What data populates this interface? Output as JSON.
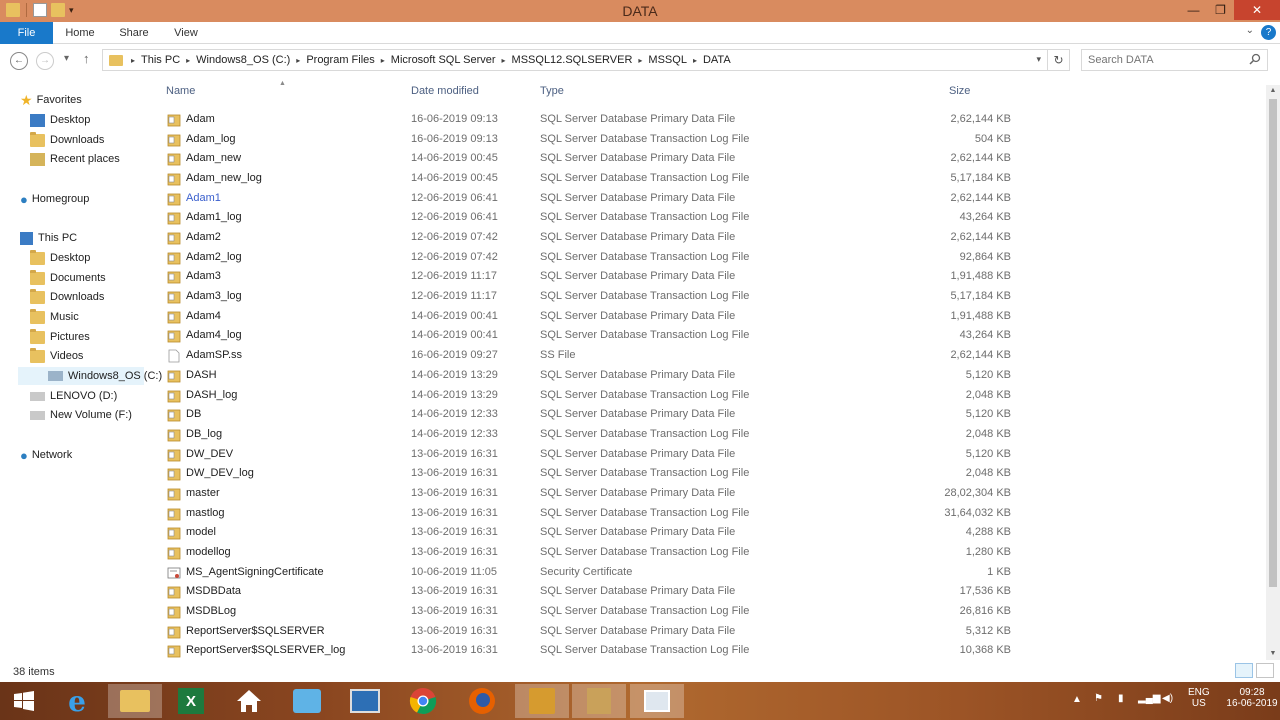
{
  "window": {
    "title": "DATA",
    "controls": {
      "minimize": "—",
      "maximize": "❐",
      "close": "✕"
    }
  },
  "ribbon": {
    "tabs": [
      "File",
      "Home",
      "Share",
      "View"
    ],
    "help": "?"
  },
  "address": {
    "crumbs": [
      "This PC",
      "Windows8_OS (C:)",
      "Program Files",
      "Microsoft SQL Server",
      "MSSQL12.SQLSERVER",
      "MSSQL",
      "DATA"
    ],
    "search_placeholder": "Search DATA"
  },
  "sidebar": {
    "favorites": {
      "label": "Favorites",
      "items": [
        "Desktop",
        "Downloads",
        "Recent places"
      ]
    },
    "homegroup": "Homegroup",
    "this_pc": {
      "label": "This PC",
      "items": [
        "Desktop",
        "Documents",
        "Downloads",
        "Music",
        "Pictures",
        "Videos",
        "Windows8_OS (C:)",
        "LENOVO (D:)",
        "New Volume (F:)"
      ],
      "selected": "Windows8_OS (C:)"
    },
    "network": "Network"
  },
  "columns": {
    "name": "Name",
    "date": "Date modified",
    "type": "Type",
    "size": "Size"
  },
  "files": [
    {
      "name": "Adam",
      "date": "16-06-2019 09:13",
      "type": "SQL Server Database Primary Data File",
      "size": "2,62,144 KB",
      "icon": "db-file-icon"
    },
    {
      "name": "Adam_log",
      "date": "16-06-2019 09:13",
      "type": "SQL Server Database Transaction Log File",
      "size": "504 KB",
      "icon": "db-file-icon"
    },
    {
      "name": "Adam_new",
      "date": "14-06-2019 00:45",
      "type": "SQL Server Database Primary Data File",
      "size": "2,62,144 KB",
      "icon": "db-file-icon"
    },
    {
      "name": "Adam_new_log",
      "date": "14-06-2019 00:45",
      "type": "SQL Server Database Transaction Log File",
      "size": "5,17,184 KB",
      "icon": "db-file-icon"
    },
    {
      "name": "Adam1",
      "date": "12-06-2019 06:41",
      "type": "SQL Server Database Primary Data File",
      "size": "2,62,144 KB",
      "icon": "db-file-icon",
      "hover": true
    },
    {
      "name": "Adam1_log",
      "date": "12-06-2019 06:41",
      "type": "SQL Server Database Transaction Log File",
      "size": "43,264 KB",
      "icon": "db-file-icon"
    },
    {
      "name": "Adam2",
      "date": "12-06-2019 07:42",
      "type": "SQL Server Database Primary Data File",
      "size": "2,62,144 KB",
      "icon": "db-file-icon"
    },
    {
      "name": "Adam2_log",
      "date": "12-06-2019 07:42",
      "type": "SQL Server Database Transaction Log File",
      "size": "92,864 KB",
      "icon": "db-file-icon"
    },
    {
      "name": "Adam3",
      "date": "12-06-2019 11:17",
      "type": "SQL Server Database Primary Data File",
      "size": "1,91,488 KB",
      "icon": "db-file-icon"
    },
    {
      "name": "Adam3_log",
      "date": "12-06-2019 11:17",
      "type": "SQL Server Database Transaction Log File",
      "size": "5,17,184 KB",
      "icon": "db-file-icon"
    },
    {
      "name": "Adam4",
      "date": "14-06-2019 00:41",
      "type": "SQL Server Database Primary Data File",
      "size": "1,91,488 KB",
      "icon": "db-file-icon"
    },
    {
      "name": "Adam4_log",
      "date": "14-06-2019 00:41",
      "type": "SQL Server Database Transaction Log File",
      "size": "43,264 KB",
      "icon": "db-file-icon"
    },
    {
      "name": "AdamSP.ss",
      "date": "16-06-2019 09:27",
      "type": "SS File",
      "size": "2,62,144 KB",
      "icon": "blank-file-icon"
    },
    {
      "name": "DASH",
      "date": "14-06-2019 13:29",
      "type": "SQL Server Database Primary Data File",
      "size": "5,120 KB",
      "icon": "db-file-icon"
    },
    {
      "name": "DASH_log",
      "date": "14-06-2019 13:29",
      "type": "SQL Server Database Transaction Log File",
      "size": "2,048 KB",
      "icon": "db-file-icon"
    },
    {
      "name": "DB",
      "date": "14-06-2019 12:33",
      "type": "SQL Server Database Primary Data File",
      "size": "5,120 KB",
      "icon": "db-file-icon"
    },
    {
      "name": "DB_log",
      "date": "14-06-2019 12:33",
      "type": "SQL Server Database Transaction Log File",
      "size": "2,048 KB",
      "icon": "db-file-icon"
    },
    {
      "name": "DW_DEV",
      "date": "13-06-2019 16:31",
      "type": "SQL Server Database Primary Data File",
      "size": "5,120 KB",
      "icon": "db-file-icon"
    },
    {
      "name": "DW_DEV_log",
      "date": "13-06-2019 16:31",
      "type": "SQL Server Database Transaction Log File",
      "size": "2,048 KB",
      "icon": "db-file-icon"
    },
    {
      "name": "master",
      "date": "13-06-2019 16:31",
      "type": "SQL Server Database Primary Data File",
      "size": "28,02,304 KB",
      "icon": "db-file-icon"
    },
    {
      "name": "mastlog",
      "date": "13-06-2019 16:31",
      "type": "SQL Server Database Transaction Log File",
      "size": "31,64,032 KB",
      "icon": "db-file-icon"
    },
    {
      "name": "model",
      "date": "13-06-2019 16:31",
      "type": "SQL Server Database Primary Data File",
      "size": "4,288 KB",
      "icon": "db-file-icon"
    },
    {
      "name": "modellog",
      "date": "13-06-2019 16:31",
      "type": "SQL Server Database Transaction Log File",
      "size": "1,280 KB",
      "icon": "db-file-icon"
    },
    {
      "name": "MS_AgentSigningCertificate",
      "date": "10-06-2019 11:05",
      "type": "Security Certificate",
      "size": "1 KB",
      "icon": "certificate-icon"
    },
    {
      "name": "MSDBData",
      "date": "13-06-2019 16:31",
      "type": "SQL Server Database Primary Data File",
      "size": "17,536 KB",
      "icon": "db-file-icon"
    },
    {
      "name": "MSDBLog",
      "date": "13-06-2019 16:31",
      "type": "SQL Server Database Transaction Log File",
      "size": "26,816 KB",
      "icon": "db-file-icon"
    },
    {
      "name": "ReportServer$SQLSERVER",
      "date": "13-06-2019 16:31",
      "type": "SQL Server Database Primary Data File",
      "size": "5,312 KB",
      "icon": "db-file-icon"
    },
    {
      "name": "ReportServer$SQLSERVER_log",
      "date": "13-06-2019 16:31",
      "type": "SQL Server Database Transaction Log File",
      "size": "10,368 KB",
      "icon": "db-file-icon"
    }
  ],
  "status": {
    "item_count": "38 items"
  },
  "taskbar": {
    "apps": [
      "start-icon",
      "internet-explorer-icon",
      "file-explorer-icon",
      "excel-icon",
      "home-icon",
      "outlook-icon",
      "remote-desktop-icon",
      "chrome-icon",
      "firefox-icon",
      "sql-server-icon",
      "sql-tools-icon",
      "window-icon"
    ],
    "active": "file-explorer-icon",
    "lang_top": "ENG",
    "lang_bottom": "US",
    "time": "09:28",
    "date": "16-06-2019"
  },
  "colors": {
    "accent": "#1979ca",
    "titlebar": "#d98b5f",
    "close": "#c7442e",
    "header_text": "#4d6082"
  }
}
